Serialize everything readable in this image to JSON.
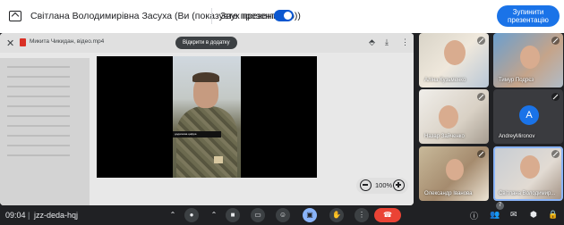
{
  "topbar": {
    "presenter_title": "Світлана Володимирівна Засуха (Ви (показуєте презентацію))",
    "sound_label": "Звук презентації",
    "stop_label_line1": "Зупинити",
    "stop_label_line2": "презентацію",
    "colors": {
      "accent": "#1a73e8",
      "toggle": "#0b57d0"
    }
  },
  "stage": {
    "file_name": "Микита Чикидан, відео.mp4",
    "open_with": "Відкрити в додатку",
    "video_caption": "додаткова цифра",
    "zoom_value": "100%"
  },
  "participants": [
    {
      "name": "Аліна Кузьменко"
    },
    {
      "name": "Тимур Подрєз"
    },
    {
      "name": "Назар Зайченко"
    },
    {
      "name": "AndreyMironov",
      "avatar": "A"
    },
    {
      "name": "Олександр Іванова"
    },
    {
      "name": "Світлана Володимир..."
    }
  ],
  "bottombar": {
    "time": "09:04",
    "separator": "|",
    "meeting_code": "jzz-deda-hqj",
    "people_badge": "7"
  }
}
